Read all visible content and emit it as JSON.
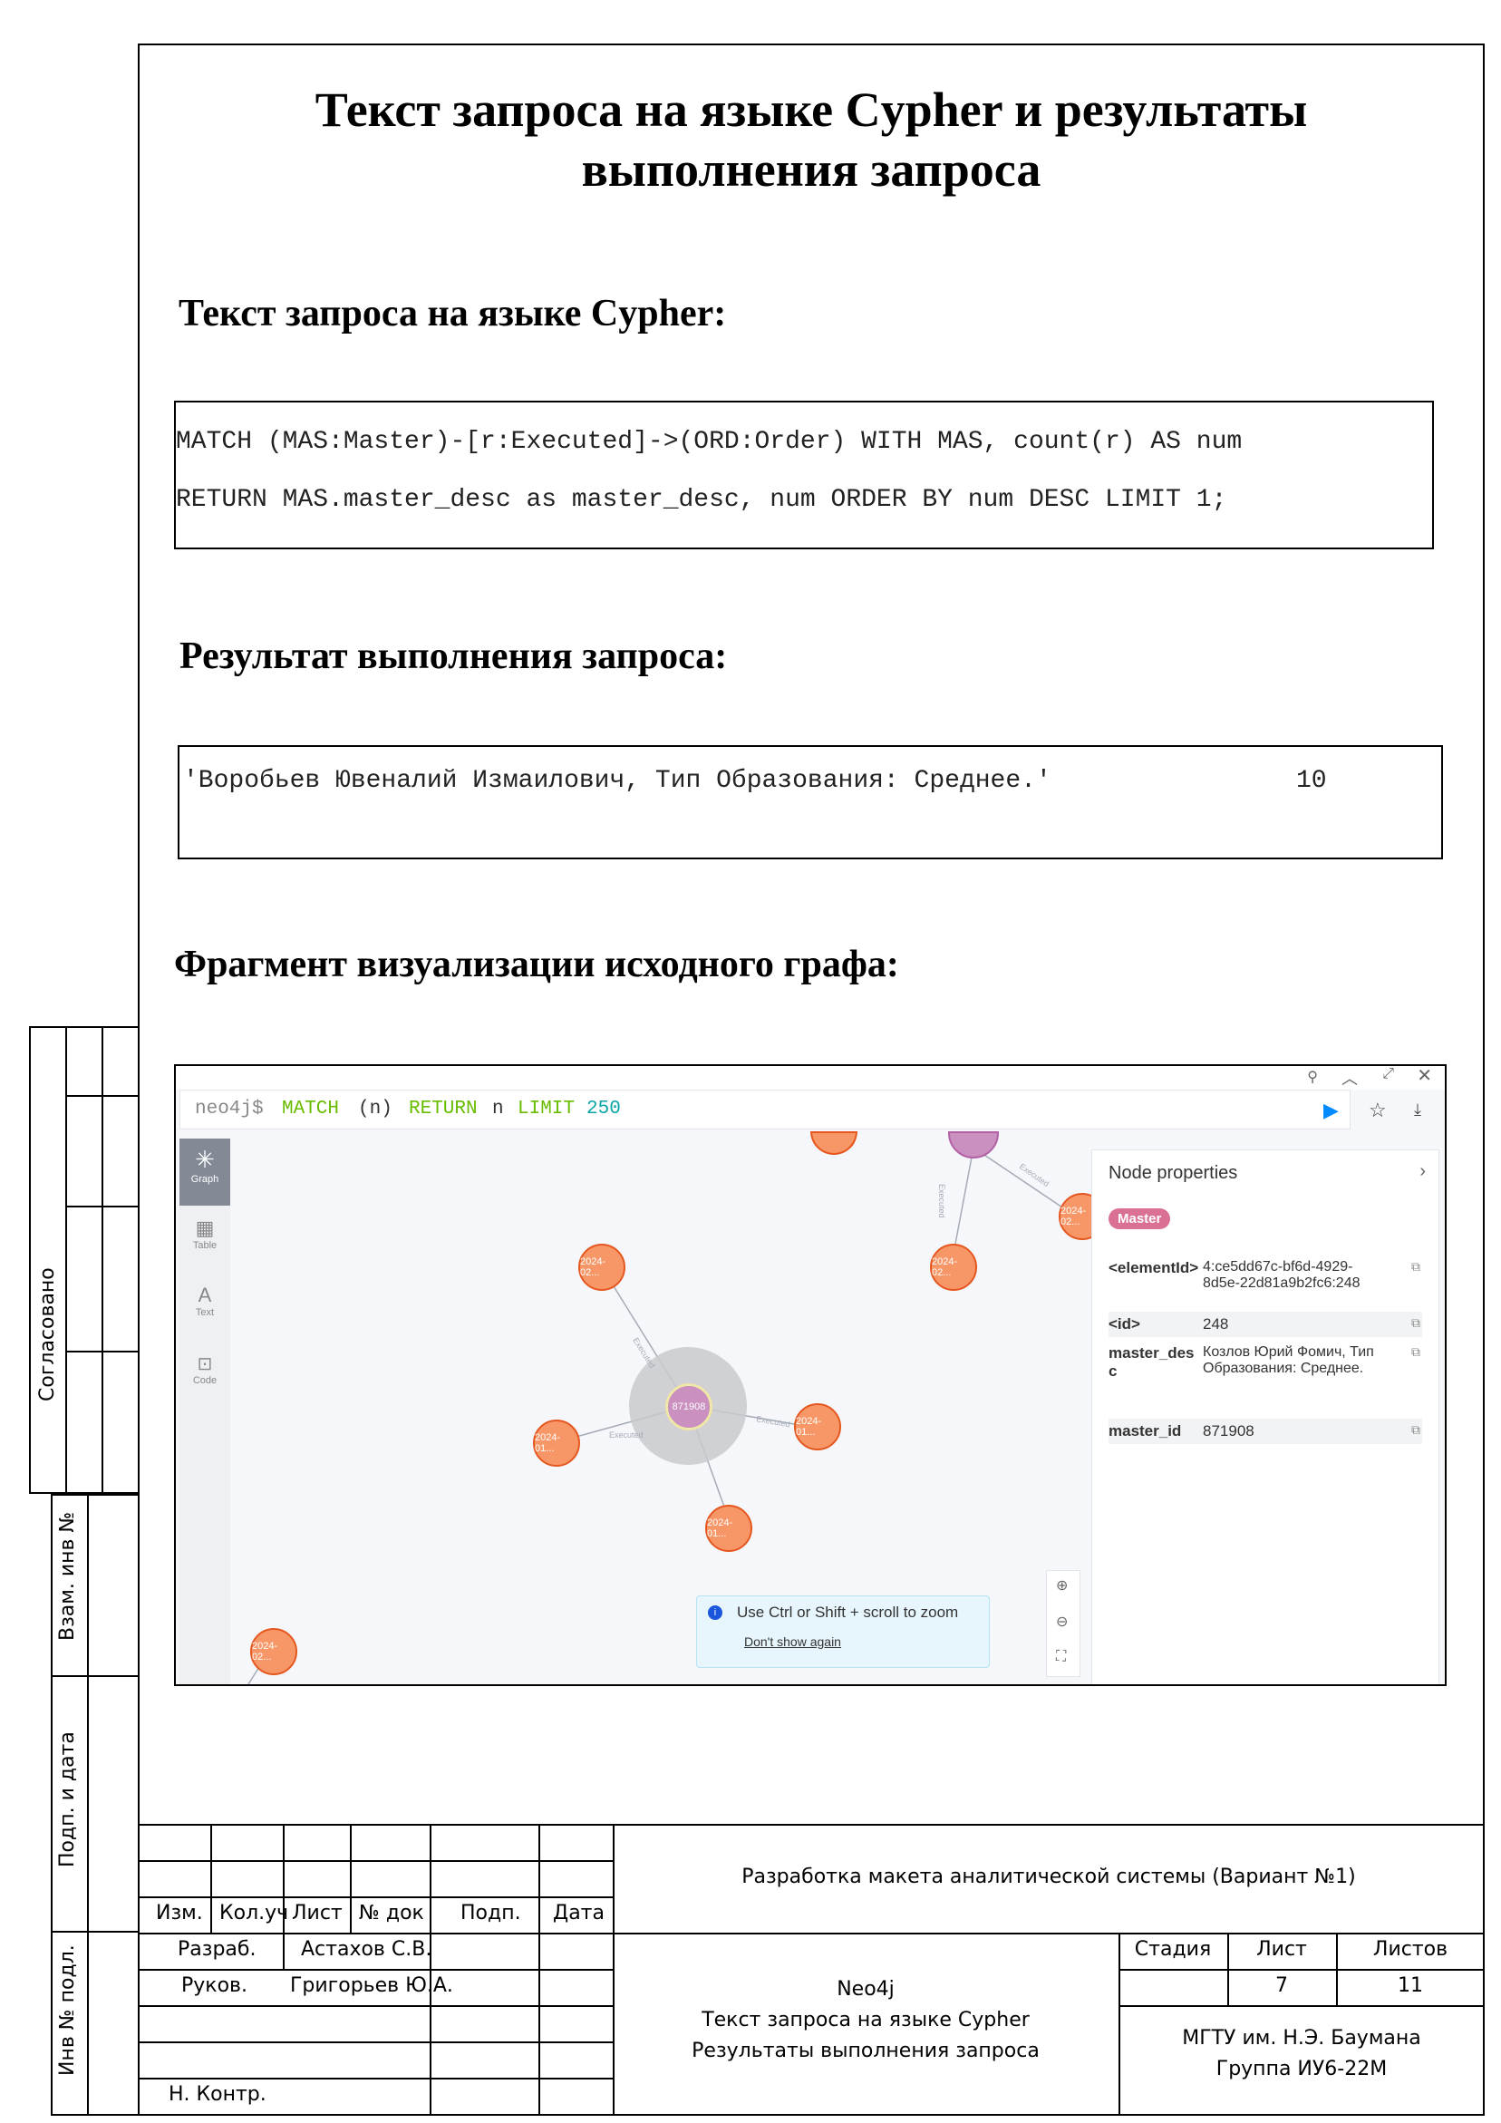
{
  "page": {
    "title_line1": "Текст запроса на языке Cypher и результаты",
    "title_line2": "выполнения запроса",
    "query_heading": "Текст запроса на языке Cypher:",
    "query_line1": "MATCH (MAS:Master)-[r:Executed]->(ORD:Order) WITH MAS, count(r) AS num",
    "query_line2": "RETURN MAS.master_desc as master_desc, num ORDER BY num DESC LIMIT 1;",
    "result_heading": "Результат выполнения запроса:",
    "result_text": "'Воробьев Ювеналий Измаилович, Тип Образования: Среднее.'",
    "result_num": "10",
    "graph_heading": "Фрагмент визуализации исходного графа:"
  },
  "neo4j": {
    "prompt": "neo4j$",
    "query_kw1": "MATCH",
    "query_var1": "(n)",
    "query_kw2": "RETURN",
    "query_var2": "n",
    "query_kw3": "LIMIT",
    "query_num": "250",
    "side_graph": "Graph",
    "side_table": "Table",
    "side_text": "Text",
    "side_code": "Code",
    "center_node": "871908",
    "node_labels": [
      "2024-02...",
      "2024-01...",
      "2024-01...",
      "2024-01...",
      "2024-02...",
      "2024-02...",
      "2024-02..."
    ],
    "edge_label": "Executed",
    "panel_title": "Node properties",
    "panel_badge": "Master",
    "props": [
      {
        "key": "<elementId>",
        "value": "4:ce5dd67c-bf6d-4929-8d5e-22d81a9b2fc6:248"
      },
      {
        "key": "<id>",
        "value": "248"
      },
      {
        "key": "master_desc",
        "value": "Козлов Юрий Фомич, Тип Образования: Среднее."
      },
      {
        "key": "master_id",
        "value": "871908"
      }
    ],
    "toast_text": "Use Ctrl or Shift + scroll to zoom",
    "toast_link": "Don't show again",
    "colors": {
      "order_node": "#f79767",
      "master_node": "#c990c0",
      "master_badge": "#da7194",
      "accent": "#018bff"
    }
  },
  "margin": {
    "agreed": "Согласовано",
    "vzam_inv": "Взам. инв №",
    "podp_data": "Подп. и дата",
    "inv_podl": "Инв № подл."
  },
  "stamp": {
    "col_izm": "Изм.",
    "col_koluch": "Кол.уч",
    "col_list": "Лист",
    "col_ndok": "№ док",
    "col_podp": "Подп.",
    "col_data": "Дата",
    "razrab": "Разраб.",
    "razrab_name": "Астахов С.В.",
    "rukov": "Руков.",
    "rukov_name": "Григорьев Ю.А.",
    "nkontr": "Н. Контр.",
    "doc_title": "Разработка макета аналитической системы (Вариант №1)",
    "sheet_line1": "Neo4j",
    "sheet_line2": "Текст запроса на языке Cypher",
    "sheet_line3": "Результаты выполнения запроса",
    "stage_label": "Стадия",
    "list_label": "Лист",
    "lists_label": "Листов",
    "list_value": "7",
    "lists_value": "11",
    "org_line1": "МГТУ им. Н.Э. Баумана",
    "org_line2": "Группа ИУ6-22М"
  }
}
